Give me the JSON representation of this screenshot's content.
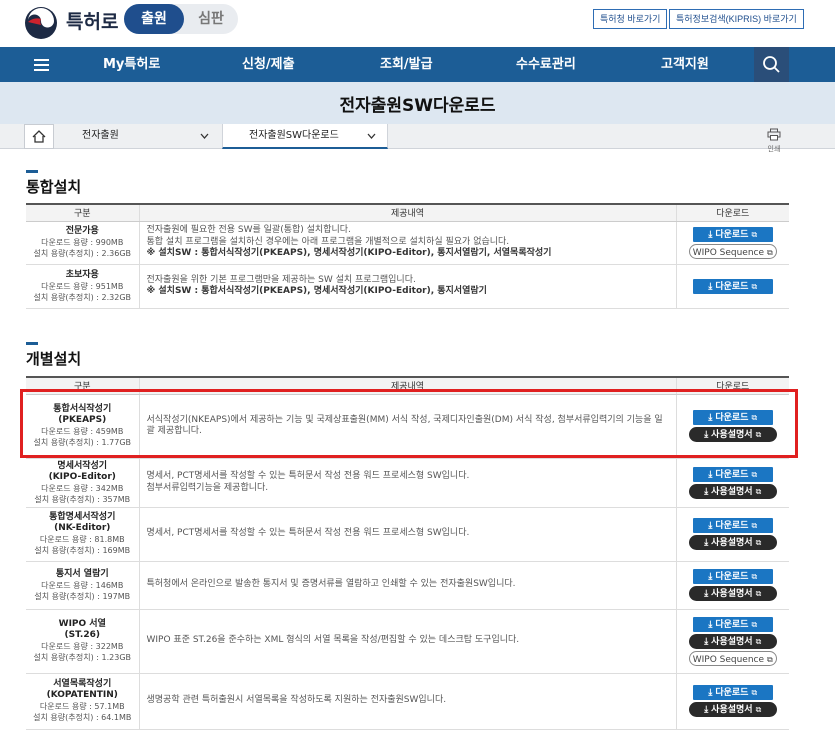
{
  "header": {
    "logo_text": "특허로",
    "seg_active": "출원",
    "seg_inactive": "심판",
    "link1": "특허청 바로가기",
    "link2": "특허정보검색(KIPRIS) 바로가기"
  },
  "nav": {
    "items": [
      "My특허로",
      "신청/제출",
      "조회/발급",
      "수수료관리",
      "고객지원"
    ]
  },
  "page_title": "전자출원SW다운로드",
  "breadcrumb": {
    "level1": "전자출원",
    "level2": "전자출원SW다운로드",
    "print_label": "인쇄"
  },
  "integrated": {
    "title": "통합설치",
    "headers": [
      "구분",
      "제공내역",
      "다운로드"
    ],
    "rows": [
      {
        "name": "전문가용",
        "size1": "다운로드 용량 : 990MB",
        "size2": "설치 용량(추정치) : 2.36GB",
        "desc1": "전자출원에 필요한 전용 SW를 일괄(통합) 설치합니다.",
        "desc2": "통합 설치 프로그램을 설치하신 경우에는 아래 프로그램을 개별적으로 설치하실 필요가 없습니다.",
        "desc3": "※ 설치SW : 통합서식작성기(PKEAPS), 명세서작성기(KIPO-Editor), 통지서열람기, 서열목록작성기",
        "download": "다운로드",
        "wipo": "WIPO Sequence"
      },
      {
        "name": "초보자용",
        "size1": "다운로드 용량 : 951MB",
        "size2": "설치 용량(추정치) : 2.32GB",
        "desc1": "전자출원을 위한 기본 프로그램만을 제공하는 SW 설치 프로그램입니다.",
        "desc2": "※ 설치SW : 통합서식작성기(PKEAPS), 명세서작성기(KIPO-Editor), 통지서열람기",
        "download": "다운로드"
      }
    ]
  },
  "individual": {
    "title": "개별설치",
    "headers": [
      "구분",
      "제공내역",
      "다운로드"
    ],
    "rows": [
      {
        "name": "통합서식작성기",
        "code": "(PKEAPS)",
        "size1": "다운로드 용량 : 459MB",
        "size2": "설치 용량(추정치) : 1.77GB",
        "desc": "서식작성기(NKEAPS)에서 제공하는 기능 및 국제상표출원(MM) 서식 작성, 국제디자인출원(DM) 서식 작성, 첨부서류입력기의 기능을 일괄 제공합니다.",
        "download": "다운로드",
        "manual": "사용설명서"
      },
      {
        "name": "명세서작성기",
        "code": "(KIPO-Editor)",
        "size1": "다운로드 용량 : 342MB",
        "size2": "설치 용량(추정치) : 357MB",
        "desc": "명세서, PCT명세서를 작성할 수 있는 특허문서 작성 전용 워드 프로세스형 SW입니다.",
        "desc2": "첨부서류입력기능을 제공합니다.",
        "download": "다운로드",
        "manual": "사용설명서"
      },
      {
        "name": "통합명세서작성기",
        "code": "(NK-Editor)",
        "size1": "다운로드 용량 : 81.8MB",
        "size2": "설치 용량(추정치) : 169MB",
        "desc": "명세서, PCT명세서를 작성할 수 있는 특허문서 작성 전용 워드 프로세스형 SW입니다.",
        "download": "다운로드",
        "manual": "사용설명서"
      },
      {
        "name": "통지서 열람기",
        "size1": "다운로드 용량 : 146MB",
        "size2": "설치 용량(추정치) : 197MB",
        "desc": "특허청에서 온라인으로 발송한 통지서 및 증명서류를 열람하고 인쇄할 수 있는 전자출원SW입니다.",
        "download": "다운로드",
        "manual": "사용설명서"
      },
      {
        "name": "WIPO 서열",
        "code": "(ST.26)",
        "size1": "다운로드 용량 : 322MB",
        "size2": "설치 용량(추정치) : 1.23GB",
        "desc": "WIPO 표준 ST.26을 준수하는 XML 형식의 서열 목록을 작성/편집할 수 있는 데스크탑 도구입니다.",
        "download": "다운로드",
        "manual": "사용설명서",
        "wipo": "WIPO Sequence"
      },
      {
        "name": "서열목록작성기",
        "code": "(KOPATENTIN)",
        "size1": "다운로드 용량 : 57.1MB",
        "size2": "설치 용량(추정치) : 64.1MB",
        "desc": "생명공학 관련 특허출원시 서열목록을 작성하도록 지원하는 전자출원SW입니다.",
        "download": "다운로드",
        "manual": "사용설명서"
      }
    ]
  },
  "colors": {
    "nav": "#1c5d96",
    "download": "#1b76c3",
    "manual": "#2a2a2a",
    "highlight": "#e02020"
  }
}
